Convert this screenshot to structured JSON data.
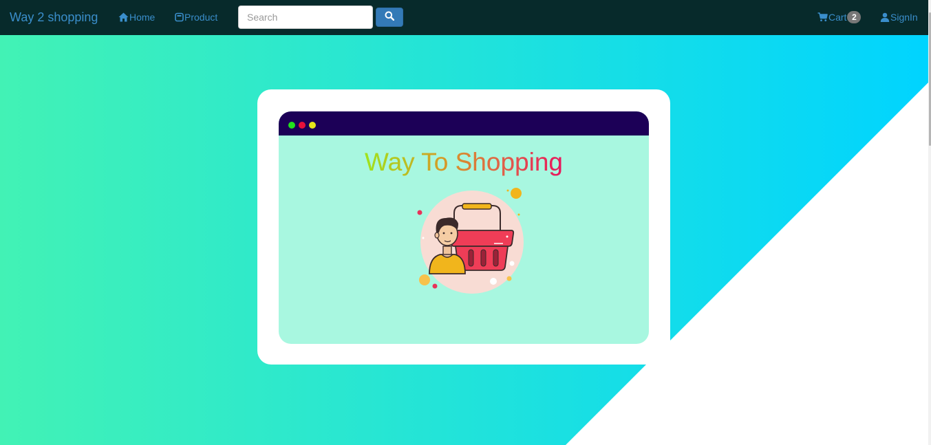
{
  "navbar": {
    "brand": "Way 2 shopping",
    "home_label": "Home",
    "product_label": "Product",
    "search_placeholder": "Search",
    "cart_label": "Cart",
    "cart_count": "2",
    "signin_label": "SignIn"
  },
  "hero": {
    "window_title": "Way To Shopping",
    "window_dots": [
      "#22e31c",
      "#e8113a",
      "#e6e61a"
    ],
    "gradient_start": "#42f2b5",
    "gradient_end": "#00d4ff"
  },
  "icons": {
    "home": "home-icon",
    "product": "product-icon",
    "search": "search-icon",
    "cart": "cart-icon",
    "signin": "user-icon",
    "illustration": "shopper-with-basket-illustration"
  },
  "colors": {
    "navbar_bg": "#072a2b",
    "link": "#3a8ecb",
    "search_button": "#337ab7",
    "window_bar": "#1c0057",
    "window_body": "#a8f7e0"
  }
}
